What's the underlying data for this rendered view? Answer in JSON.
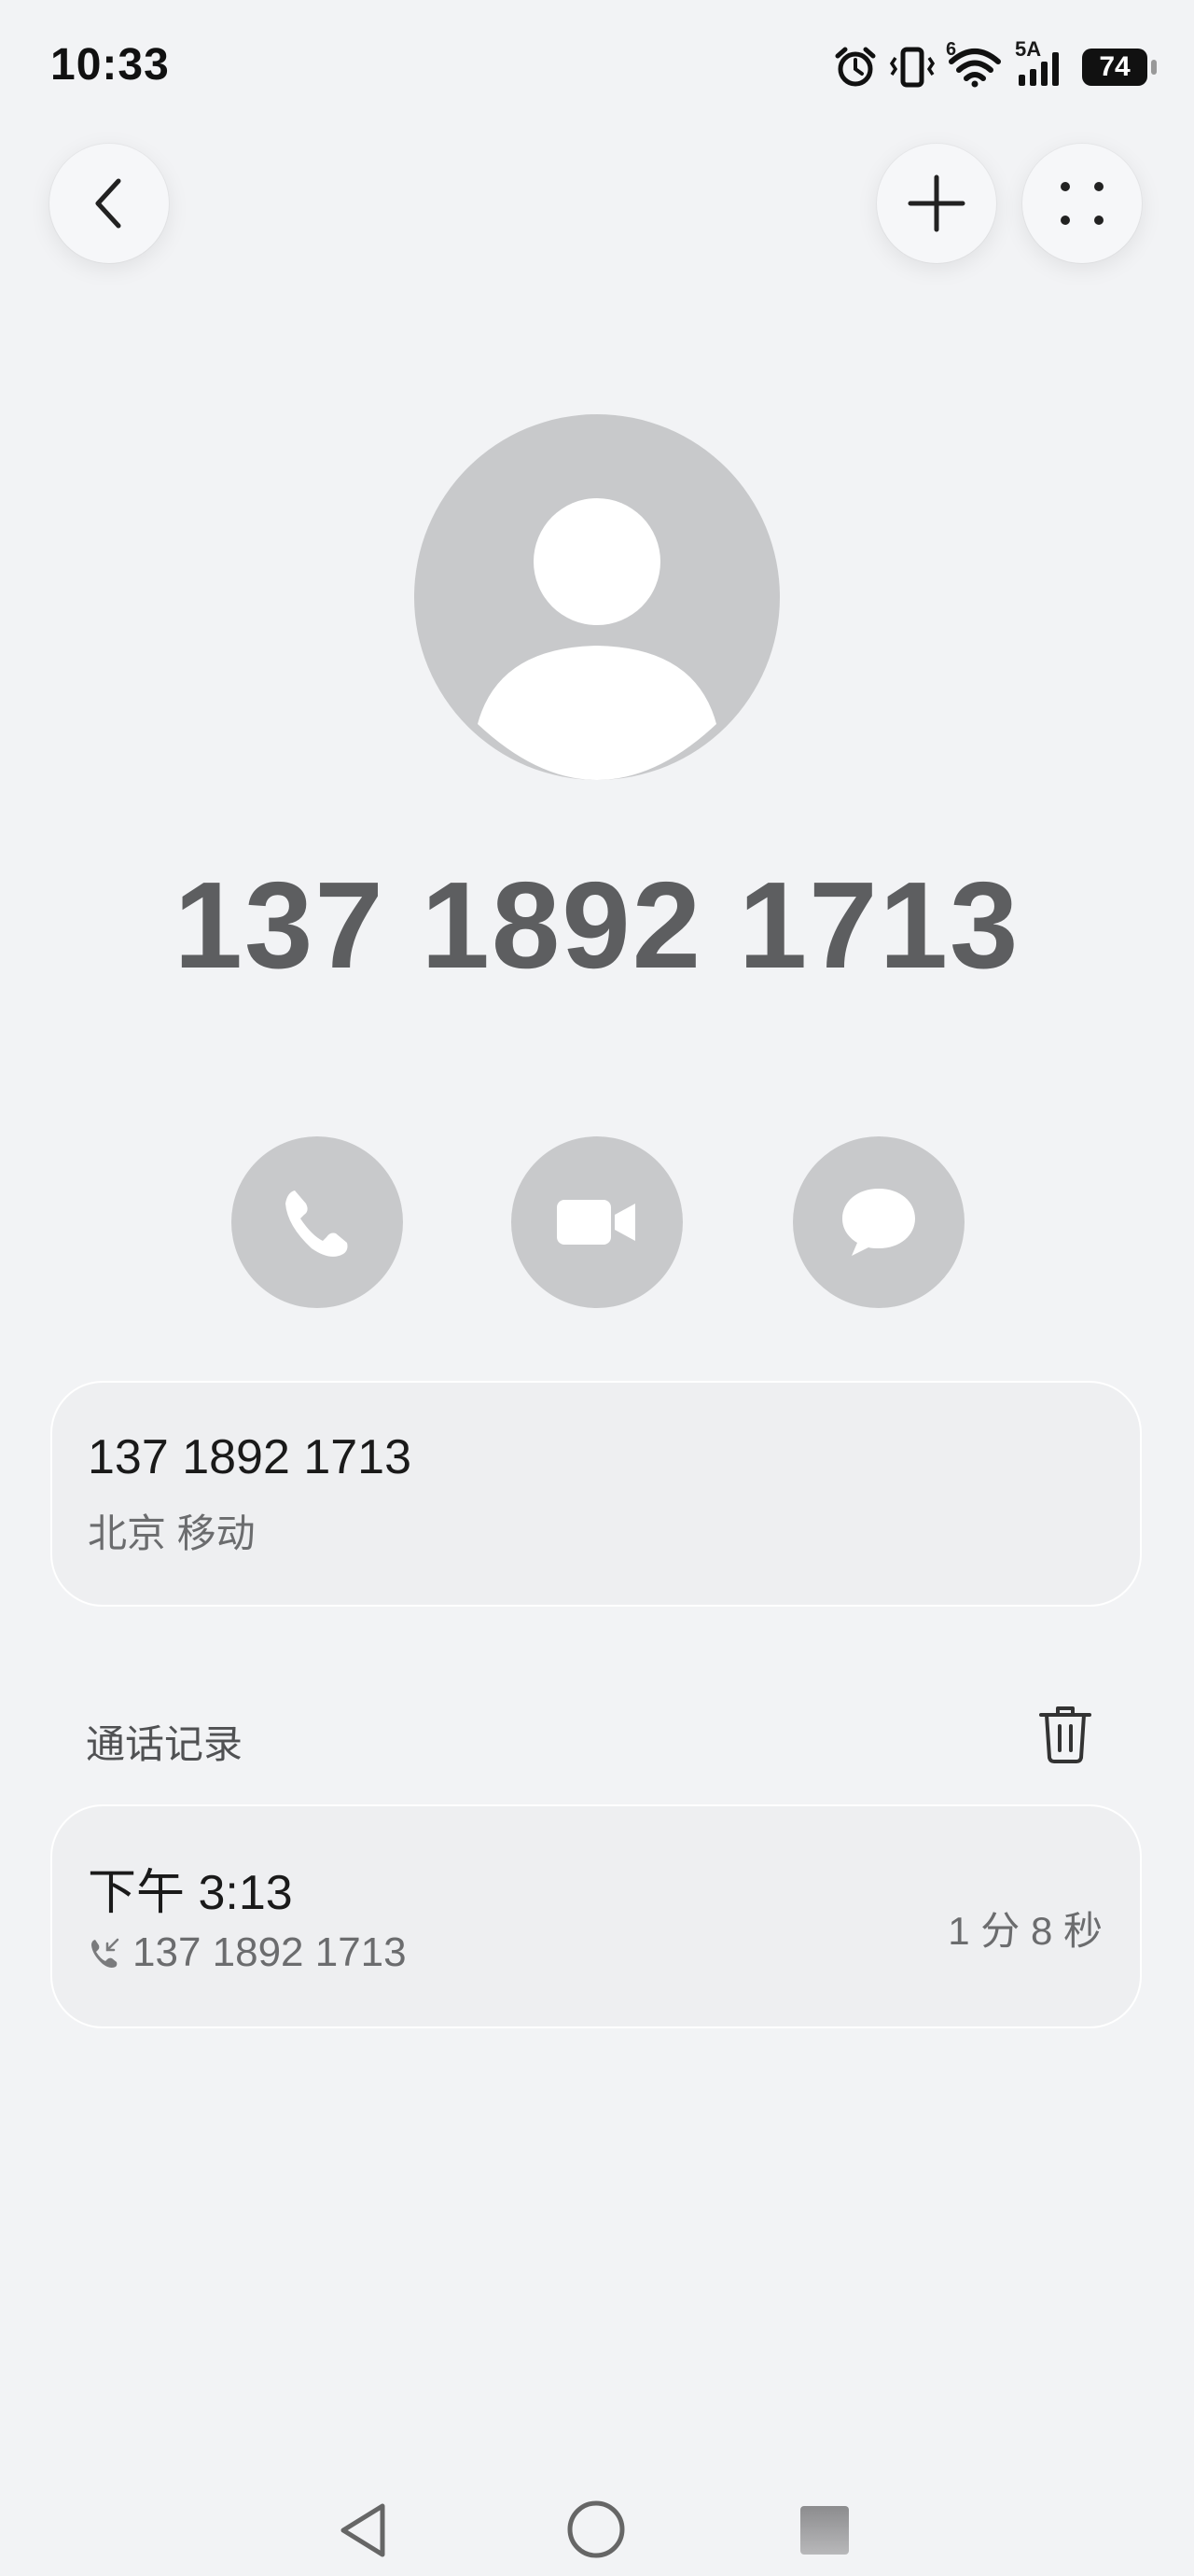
{
  "status_bar": {
    "time": "10:33",
    "signal_label": "5A",
    "wifi_label": "6",
    "battery": "74"
  },
  "contact": {
    "number": "137 1892 1713"
  },
  "info_card": {
    "number": "137 1892 1713",
    "location": "北京 移动"
  },
  "call_log": {
    "title": "通话记录",
    "entries": [
      {
        "time": "下午 3:13",
        "number": "137 1892 1713",
        "duration": "1 分 8 秒"
      }
    ]
  },
  "colors": {
    "background": "#f2f3f5",
    "avatar_bg": "#c8c9cb",
    "card_bg": "#eeeff1",
    "number_text": "#5d5e60"
  },
  "icons": {
    "back": "chevron-left-icon",
    "add": "plus-icon",
    "more": "four-dots-icon",
    "call": "phone-icon",
    "video": "video-camera-icon",
    "message": "chat-bubble-icon",
    "delete": "trash-icon"
  }
}
